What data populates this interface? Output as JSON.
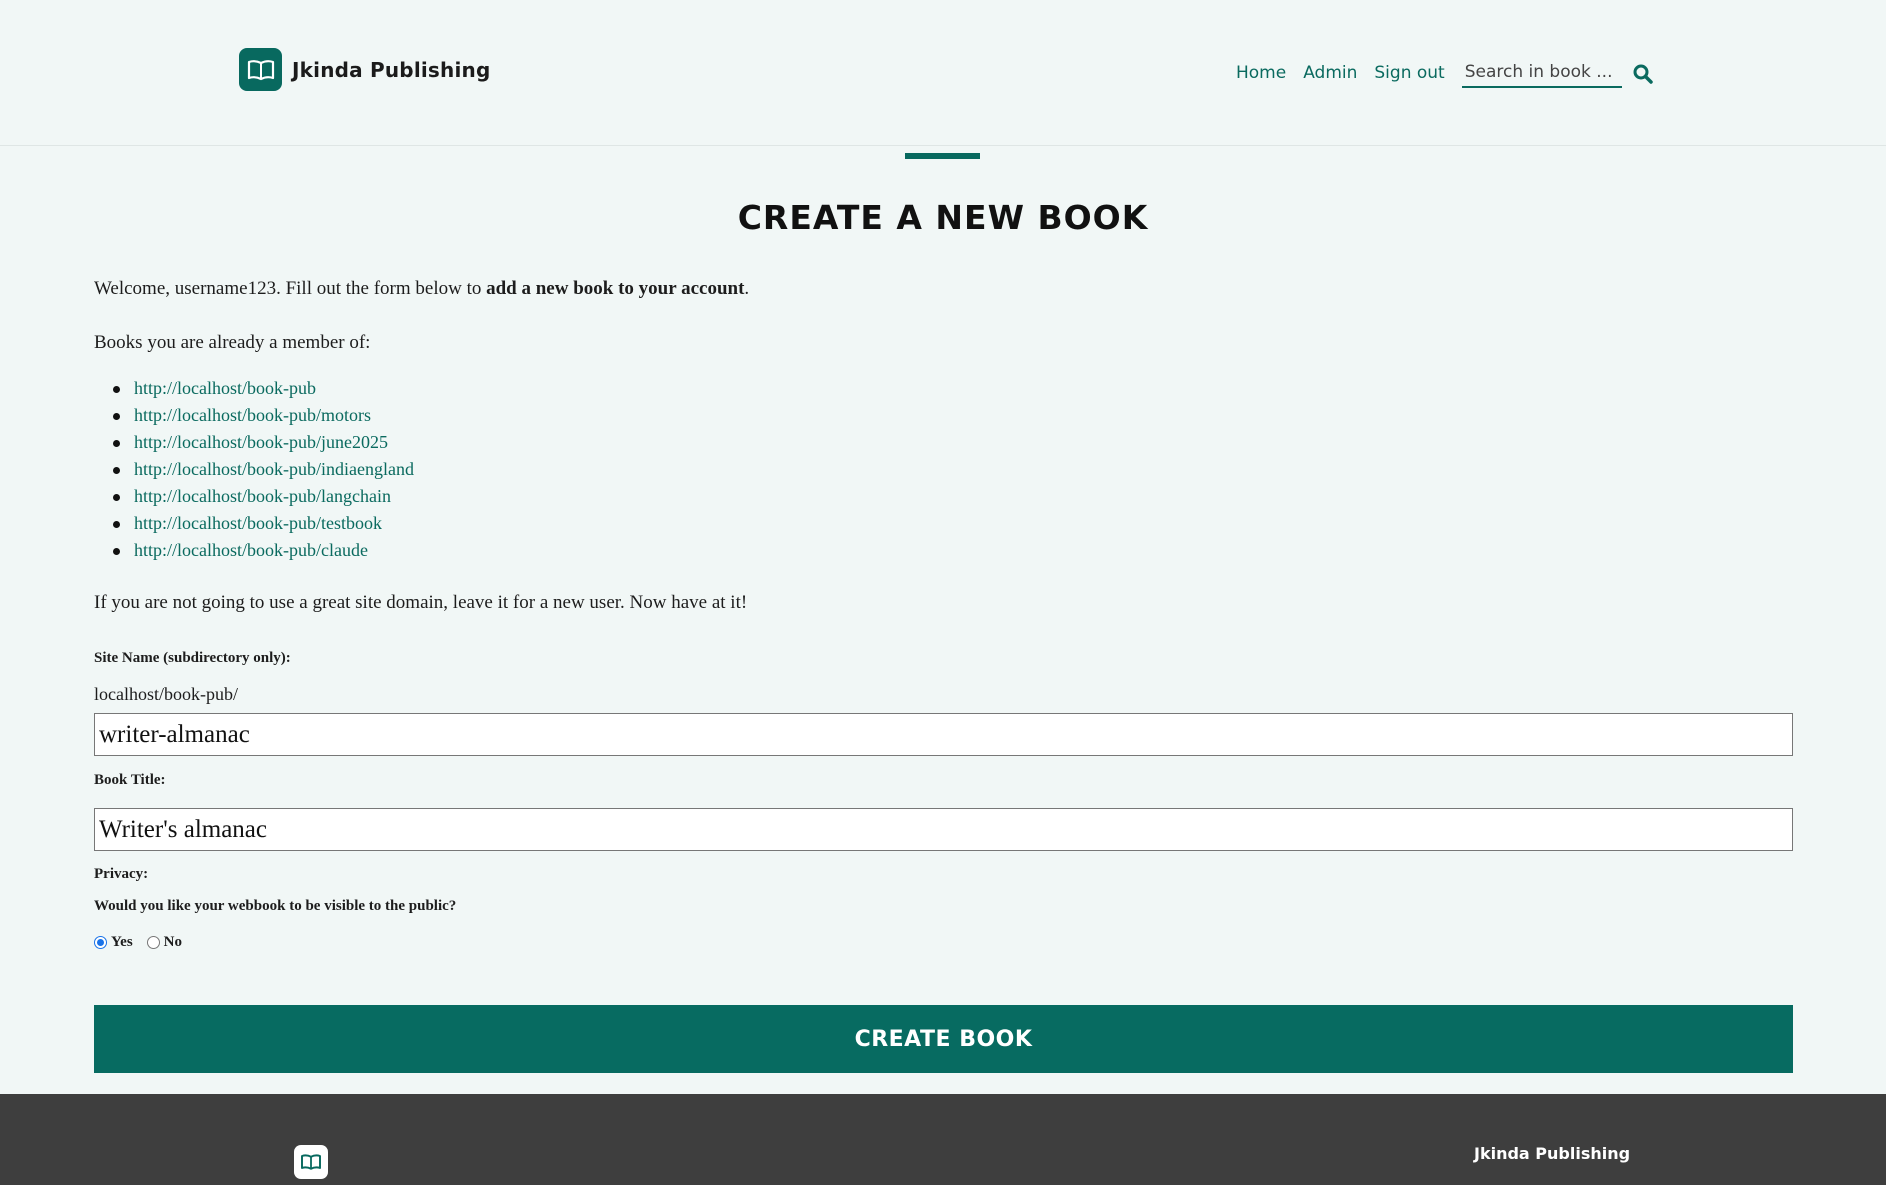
{
  "header": {
    "brand_name": "Jkinda Publishing",
    "nav": [
      {
        "label": "Home"
      },
      {
        "label": "Admin"
      },
      {
        "label": "Sign out"
      }
    ],
    "search_placeholder": "Search in book ..."
  },
  "page": {
    "title": "CREATE A NEW BOOK",
    "welcome_prefix": "Welcome, username123. Fill out the form below to ",
    "welcome_bold": "add a new book to your account",
    "welcome_suffix": ".",
    "books_intro": "Books you are already a member of:",
    "books": [
      "http://localhost/book-pub",
      "http://localhost/book-pub/motors",
      "http://localhost/book-pub/june2025",
      "http://localhost/book-pub/indiaengland",
      "http://localhost/book-pub/langchain",
      "http://localhost/book-pub/testbook",
      "http://localhost/book-pub/claude"
    ],
    "note": "If you are not going to use a great site domain, leave it for a new user. Now have at it!"
  },
  "form": {
    "site_label": "Site Name (subdirectory only):",
    "site_prefix": "localhost/book-pub/",
    "site_value": "writer-almanac",
    "title_label": "Book Title:",
    "title_value": "Writer's almanac",
    "privacy_label": "Privacy:",
    "privacy_question": "Would you like your webbook to be visible to the public?",
    "option_yes": "Yes",
    "option_no": "No",
    "selected": "Yes",
    "submit_label": "CREATE BOOK"
  },
  "footer": {
    "brand_name": "Jkinda Publishing"
  },
  "colors": {
    "accent": "#076b61",
    "background": "#f1f7f6",
    "footer": "#3e3e3e"
  }
}
